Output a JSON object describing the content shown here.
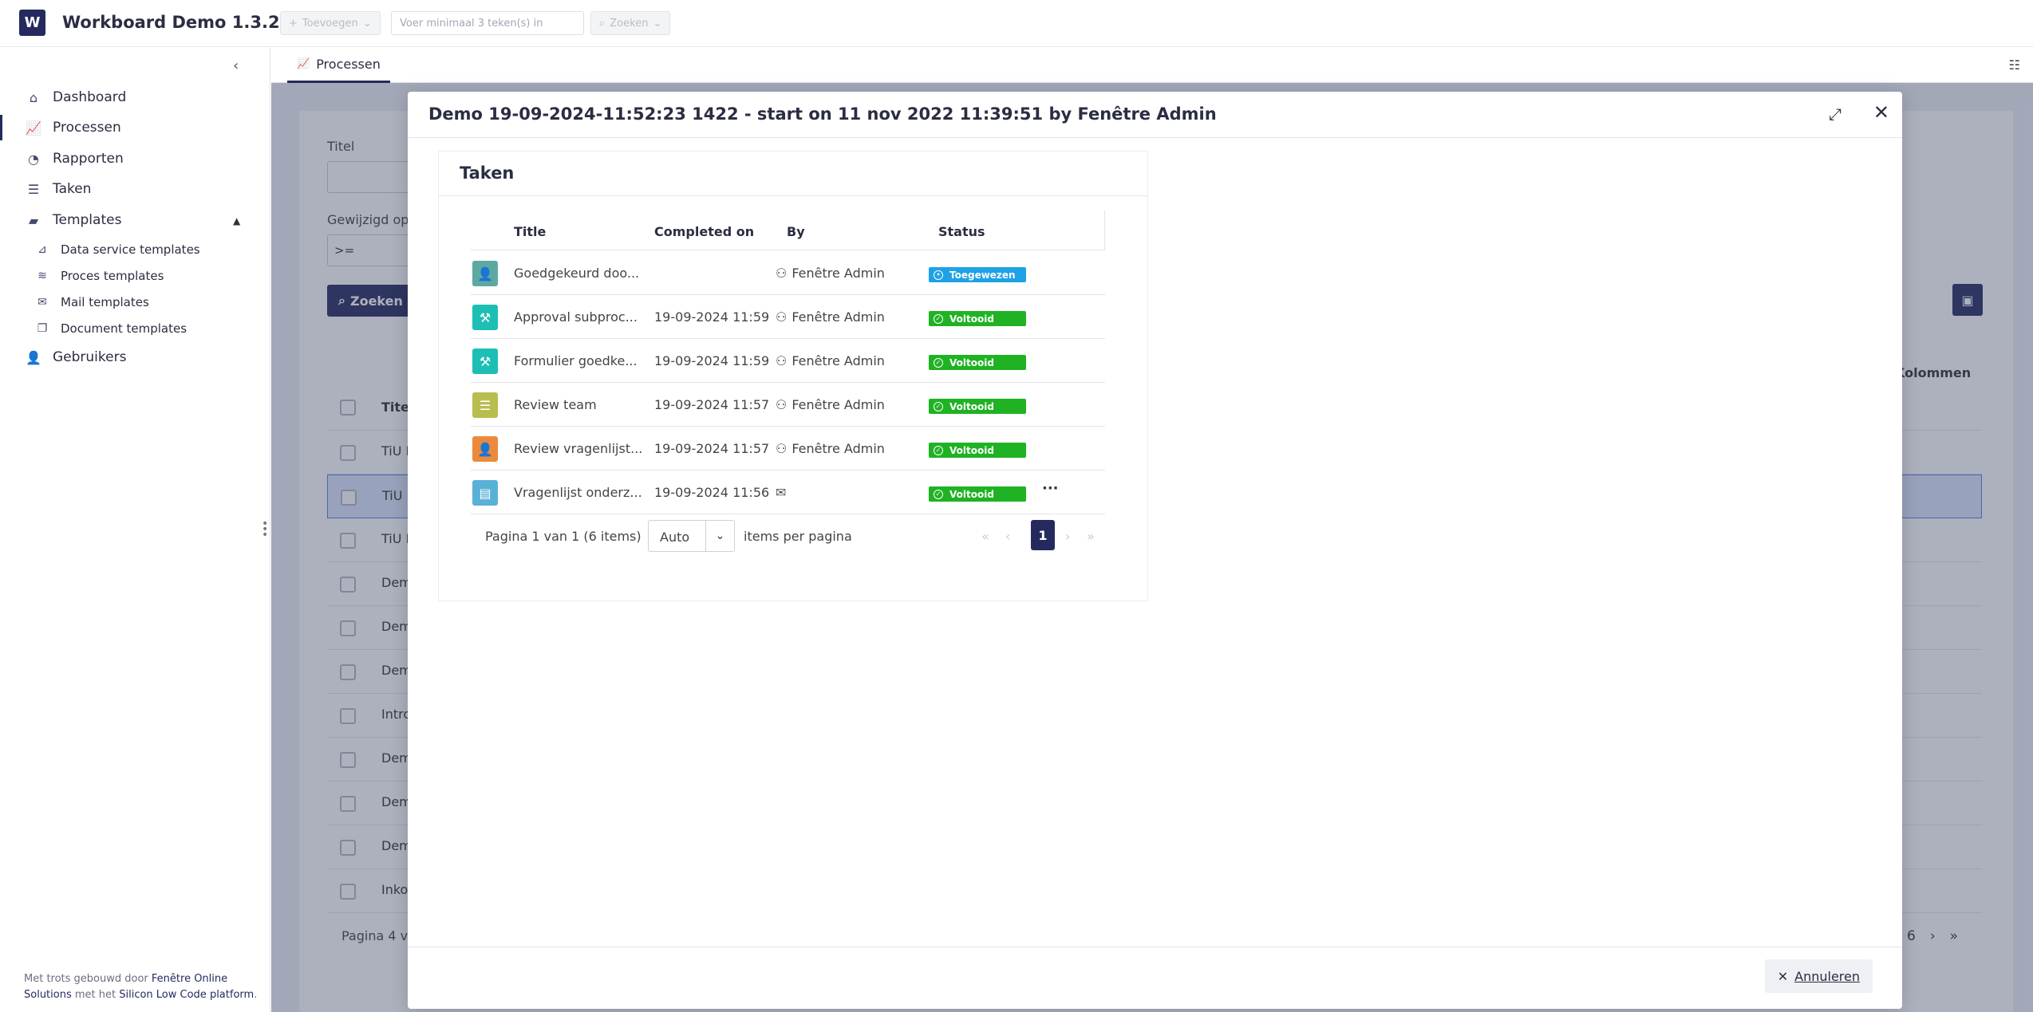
{
  "app": {
    "logo_letter": "W",
    "title": "Workboard Demo 1.3.25"
  },
  "toolbar": {
    "add_label": "Toevoegen",
    "search_placeholder": "Voer minimaal 3 teken(s) in",
    "search_label": "Zoeken"
  },
  "sidebar": {
    "items": [
      {
        "label": "Dashboard",
        "icon": "home-icon"
      },
      {
        "label": "Processen",
        "icon": "chart-line-icon"
      },
      {
        "label": "Rapporten",
        "icon": "pie-chart-icon"
      },
      {
        "label": "Taken",
        "icon": "tasks-icon"
      },
      {
        "label": "Templates",
        "icon": "box-icon"
      },
      {
        "label": "Gebruikers",
        "icon": "user-icon"
      }
    ],
    "subitems": [
      {
        "label": "Data service templates",
        "icon": "chart-icon"
      },
      {
        "label": "Proces templates",
        "icon": "layers-icon"
      },
      {
        "label": "Mail templates",
        "icon": "mail-stack-icon"
      },
      {
        "label": "Document templates",
        "icon": "documents-icon"
      }
    ],
    "footer": {
      "prefix": "Met trots gebouwd door ",
      "company": "Fenêtre Online Solutions",
      "middle": " met het ",
      "platform": "Silicon Low Code platform",
      "suffix": "."
    }
  },
  "tabs": [
    {
      "label": "Processen",
      "icon": "chart-line-icon"
    }
  ],
  "background": {
    "title_label": "Titel",
    "modified_label": "Gewijzigd op",
    "operator": ">=",
    "search_button": "Zoeken",
    "column_header": "Titel",
    "columns_button": "Kolommen",
    "rows": [
      "TiU I",
      "TiU I",
      "TiU I",
      "Dem",
      "Dem",
      "Dem",
      "Intro",
      "Dem",
      "Dem",
      "Dem",
      "Inko"
    ],
    "pager_text": "Pagina 4 va",
    "right_pager": "6"
  },
  "modal": {
    "title": "Demo 19-09-2024-11:52:23 1422 - start on 11 nov 2022 11:39:51 by Fenêtre Admin",
    "card_title": "Taken",
    "columns": {
      "title": "Title",
      "completed": "Completed on",
      "by": "By",
      "status": "Status"
    },
    "rows": [
      {
        "title": "Goedgekeurd doo...",
        "completed": "",
        "by": "Fenêtre Admin",
        "status": "Toegewezen",
        "status_color": "#1ea2e5",
        "tile_color": "#5ea8a3",
        "icon": "user-icon",
        "by_icon": "user-icon"
      },
      {
        "title": "Approval subproc...",
        "completed": "19-09-2024 11:59",
        "by": "Fenêtre Admin",
        "status": "Voltooid",
        "status_color": "#1fb323",
        "tile_color": "#1dbfb4",
        "icon": "gavel-icon",
        "by_icon": "user-icon"
      },
      {
        "title": "Formulier goedke...",
        "completed": "19-09-2024 11:59",
        "by": "Fenêtre Admin",
        "status": "Voltooid",
        "status_color": "#1fb323",
        "tile_color": "#1dbfb4",
        "icon": "gavel-icon",
        "by_icon": "user-icon"
      },
      {
        "title": "Review team",
        "completed": "19-09-2024 11:57",
        "by": "Fenêtre Admin",
        "status": "Voltooid",
        "status_color": "#1fb323",
        "tile_color": "#b8bd4f",
        "icon": "list-icon",
        "by_icon": "user-icon"
      },
      {
        "title": "Review vragenlijst...",
        "completed": "19-09-2024 11:57",
        "by": "Fenêtre Admin",
        "status": "Voltooid",
        "status_color": "#1fb323",
        "tile_color": "#ec8a3c",
        "icon": "user-check-icon",
        "by_icon": "user-icon"
      },
      {
        "title": "Vragenlijst onderz...",
        "completed": "19-09-2024 11:56",
        "by": "",
        "status": "Voltooid",
        "status_color": "#1fb323",
        "tile_color": "#5ab1d8",
        "icon": "form-icon",
        "by_icon": "envelope-icon"
      }
    ],
    "pager": {
      "info": "Pagina 1 van 1 (6 items)",
      "page_size": "Auto",
      "per_page_label": "items per pagina",
      "current_page": "1"
    },
    "cancel_label": "Annuleren"
  }
}
